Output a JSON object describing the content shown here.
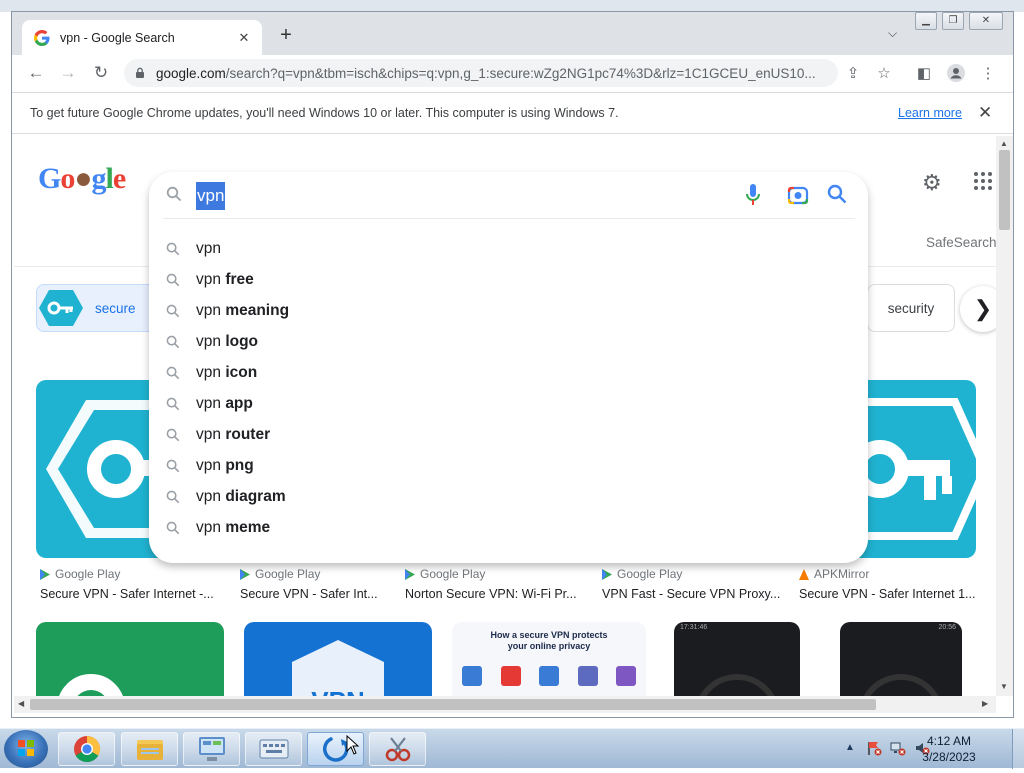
{
  "browser": {
    "tab": {
      "title": "vpn - Google Search"
    },
    "url_domain": "google.com",
    "url_path": "/search?q=vpn&tbm=isch&chips=q:vpn,g_1:secure:wZg2NG1pc74%3D&rlz=1C1GCEU_enUS10...",
    "infobar": {
      "message": "To get future Google Chrome updates, you'll need Windows 10 or later. This computer is using Windows 7.",
      "learn_more": "Learn more"
    }
  },
  "search": {
    "query": "vpn",
    "safesearch_label": "SafeSearch",
    "suggestions": [
      {
        "prefix": "vpn",
        "bold": ""
      },
      {
        "prefix": "vpn ",
        "bold": "free"
      },
      {
        "prefix": "vpn ",
        "bold": "meaning"
      },
      {
        "prefix": "vpn ",
        "bold": "logo"
      },
      {
        "prefix": "vpn ",
        "bold": "icon"
      },
      {
        "prefix": "vpn ",
        "bold": "app"
      },
      {
        "prefix": "vpn ",
        "bold": "router"
      },
      {
        "prefix": "vpn ",
        "bold": "png"
      },
      {
        "prefix": "vpn ",
        "bold": "diagram"
      },
      {
        "prefix": "vpn ",
        "bold": "meme"
      }
    ]
  },
  "chips": {
    "secure": "secure",
    "security": "security"
  },
  "results": [
    {
      "source": "Google Play",
      "caption": "Secure VPN - Safer Internet -..."
    },
    {
      "source": "Google Play",
      "caption": "Secure VPN - Safer Int..."
    },
    {
      "source": "Google Play",
      "caption": "Norton Secure VPN: Wi-Fi Pr..."
    },
    {
      "source": "Google Play",
      "caption": "VPN Fast - Secure VPN Proxy..."
    },
    {
      "source": "APKMirror",
      "caption": "Secure VPN - Safer Internet 1..."
    }
  ],
  "row2": {
    "vpn_text": "VPN",
    "diagram_title": "How a secure VPN protects your online privacy",
    "phone_time": "17:31:46",
    "phone_time2": "20:56"
  },
  "taskbar": {
    "time": "4:12 AM",
    "date": "3/28/2023"
  },
  "colors": {
    "accent_blue": "#1a73e8",
    "vpn_teal": "#1fb3d1",
    "selection_blue": "#3e79e0",
    "taskbar": "#a9c1dc"
  }
}
